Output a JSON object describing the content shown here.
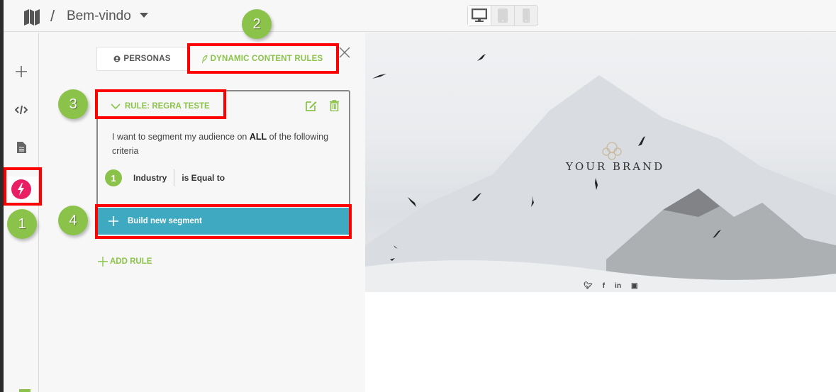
{
  "header": {
    "logo_icon": "map-icon",
    "breadcrumb_separator": "/",
    "page_title": "Bem-vindo",
    "dropdown_icon": "caret-down-icon",
    "device_modes": [
      {
        "name": "desktop",
        "icon": "desktop-icon",
        "active": true
      },
      {
        "name": "tablet",
        "icon": "tablet-icon",
        "active": false
      },
      {
        "name": "mobile",
        "icon": "mobile-icon",
        "active": false
      }
    ]
  },
  "sidebar": {
    "items": [
      {
        "name": "add",
        "icon": "plus-icon"
      },
      {
        "name": "code",
        "icon": "code-icon"
      },
      {
        "name": "page",
        "icon": "document-icon"
      },
      {
        "name": "dynamic-content",
        "icon": "lightning-icon",
        "active": true
      }
    ]
  },
  "panel": {
    "tabs": [
      {
        "label": "PERSONAS",
        "icon": "user-circle-icon",
        "active": false
      },
      {
        "label": "DYNAMIC CONTENT RULES",
        "icon": "leaf-icon",
        "active": true
      }
    ],
    "close_icon": "close-icon",
    "rule": {
      "title": "RULE: REGRA TESTE",
      "description_pre": "I want to segment my audience on ",
      "description_bold": "ALL",
      "description_post": " of the following criteria",
      "criteria": [
        {
          "number": "1",
          "field": "Industry",
          "operator": "is Equal to"
        }
      ],
      "build_segment_label": "Build new segment"
    },
    "add_rule_label": "ADD RULE"
  },
  "preview": {
    "brand_text": "YOUR BRAND",
    "social_icons": [
      "twitter-icon",
      "facebook-icon",
      "linkedin-icon",
      "youtube-icon"
    ],
    "social_labels": [
      "ὂ6",
      "f",
      "in",
      "▣"
    ]
  },
  "annotations": {
    "callouts": [
      "1",
      "2",
      "3",
      "4"
    ],
    "highlight_color": "#ff0000",
    "callout_color": "#8bc34a"
  },
  "colors": {
    "accent_green": "#8bc34a",
    "build_button": "#3ea9c1",
    "active_sidebar": "#e91e63"
  }
}
